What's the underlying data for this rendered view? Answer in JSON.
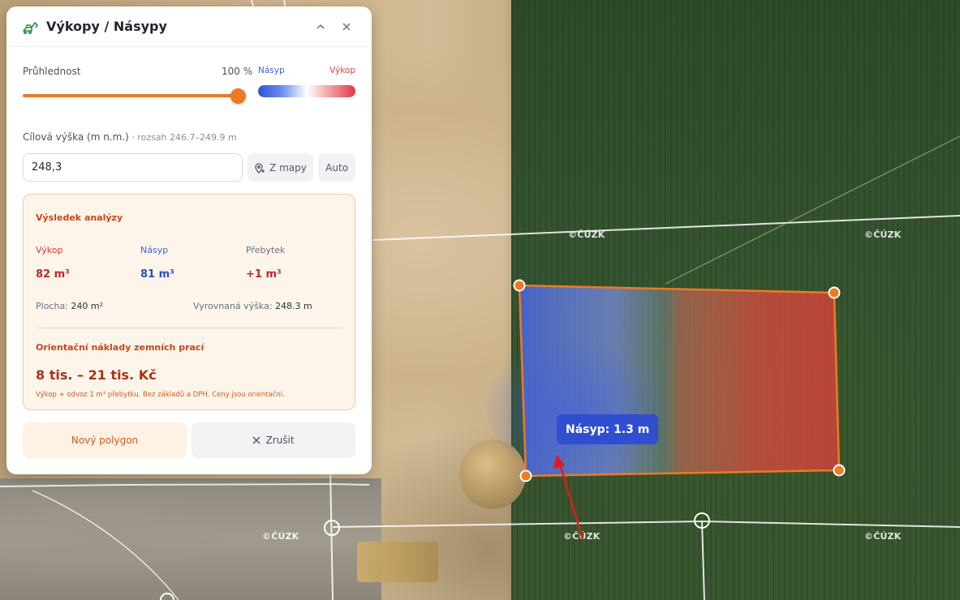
{
  "panel": {
    "title": "Výkopy / Násypy",
    "opacity_label": "Průhlednost",
    "opacity_value": "100 %",
    "opacity_level": 1.0,
    "legend": {
      "fill_label": "Násyp",
      "cut_label": "Výkop"
    },
    "target_label": "Cílová výška (m n.m.)",
    "target_range": " · rozsah 246.7–249.9 m",
    "target_value": "248,3",
    "from_map_label": "Z mapy",
    "auto_label": "Auto",
    "result": {
      "title": "Výsledek analýzy",
      "cut_label": "Výkop",
      "cut_value": "82 m³",
      "fill_label": "Násyp",
      "fill_value": "81 m³",
      "surplus_label": "Přebytek",
      "surplus_value": "+1 m³",
      "area_label": "Plocha:",
      "area_value": "240 m²",
      "level_label": "Vyrovnaná výška:",
      "level_value": "248.3 m",
      "cost_title": "Orientační náklady zemních prací",
      "cost_value": "8 tis. – 21 tis. Kč",
      "cost_note": "Výkop + odvoz 1 m³ přebytku. Bez základů a DPH. Ceny jsou orientační."
    },
    "new_polygon_label": "Nový polygon",
    "cancel_label": "Zrušit"
  },
  "map": {
    "tooltip": "Násyp: 1.3 m",
    "watermarks": [
      "©ČÚZK",
      "©ČÚZK",
      "©ČÚZK",
      "©ČÚZK",
      "©ČÚZK"
    ]
  },
  "colors": {
    "accent": "#ee7a22",
    "fill_blue": "#2f52d8",
    "cut_red": "#e23a44"
  }
}
